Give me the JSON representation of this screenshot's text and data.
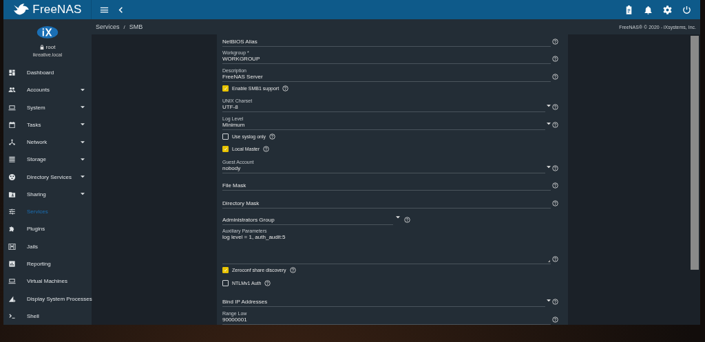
{
  "topbar": {
    "brand": "FreeNAS"
  },
  "sidebar": {
    "user": "root",
    "host": "ikreative.local",
    "items": [
      {
        "label": "Dashboard",
        "expandable": false,
        "selected": false
      },
      {
        "label": "Accounts",
        "expandable": true,
        "selected": false
      },
      {
        "label": "System",
        "expandable": true,
        "selected": false
      },
      {
        "label": "Tasks",
        "expandable": true,
        "selected": false
      },
      {
        "label": "Network",
        "expandable": true,
        "selected": false
      },
      {
        "label": "Storage",
        "expandable": true,
        "selected": false
      },
      {
        "label": "Directory Services",
        "expandable": true,
        "selected": false
      },
      {
        "label": "Sharing",
        "expandable": true,
        "selected": false
      },
      {
        "label": "Services",
        "expandable": false,
        "selected": true
      },
      {
        "label": "Plugins",
        "expandable": false,
        "selected": false
      },
      {
        "label": "Jails",
        "expandable": false,
        "selected": false
      },
      {
        "label": "Reporting",
        "expandable": false,
        "selected": false
      },
      {
        "label": "Virtual Machines",
        "expandable": false,
        "selected": false
      },
      {
        "label": "Display System Processes",
        "expandable": false,
        "selected": false
      },
      {
        "label": "Shell",
        "expandable": false,
        "selected": false
      }
    ]
  },
  "breadcrumb": [
    "Services",
    "SMB"
  ],
  "breadcrumb_separator": "/",
  "copyright": "FreeNAS® © 2020 - iXsystems, Inc.",
  "form": {
    "fields": [
      {
        "kind": "text",
        "placeholder": "NetBIOS Alias"
      },
      {
        "kind": "text",
        "label": "Workgroup *",
        "value": "WORKGROUP"
      },
      {
        "kind": "text",
        "label": "Description",
        "value": "FreeNAS Server"
      },
      {
        "kind": "checkbox",
        "label": "Enable SMB1 support",
        "checked": true
      },
      {
        "kind": "select",
        "label": "UNIX Charset",
        "value": "UTF-8"
      },
      {
        "kind": "select",
        "label": "Log Level",
        "value": "Minimum"
      },
      {
        "kind": "checkbox",
        "label": "Use syslog only",
        "checked": false
      },
      {
        "kind": "checkbox",
        "label": "Local Master",
        "checked": true
      },
      {
        "kind": "select",
        "label": "Guest Account",
        "value": "nobody"
      },
      {
        "kind": "text",
        "placeholder": "File Mask"
      },
      {
        "kind": "text",
        "placeholder": "Directory Mask"
      },
      {
        "kind": "select_short",
        "placeholder": "Administrators Group"
      },
      {
        "kind": "textarea",
        "label": "Auxiliary Parameters",
        "value": "log level = 1, auth_audit:5"
      },
      {
        "kind": "checkbox",
        "label": "Zeroconf share discovery",
        "checked": true
      },
      {
        "kind": "checkbox",
        "label": "NTLMv1 Auth",
        "checked": false
      },
      {
        "kind": "select",
        "placeholder": "Bind IP Addresses"
      },
      {
        "kind": "text",
        "label": "Range Low",
        "value": "90000001"
      }
    ]
  }
}
